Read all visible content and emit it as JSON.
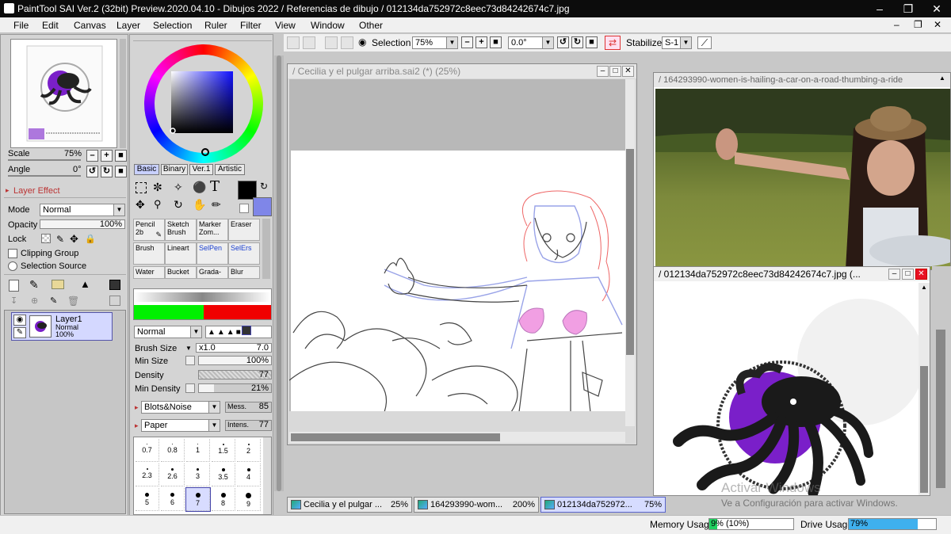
{
  "app": {
    "title": "PaintTool SAI Ver.2 (32bit) Preview.2020.04.10 - Dibujos 2022 / Referencias de dibujo / 012134da752972c8eec73d84242674c7.jpg"
  },
  "menu": [
    "File",
    "Edit",
    "Canvas",
    "Layer",
    "Selection",
    "Ruler",
    "Filter",
    "View",
    "Window",
    "Other"
  ],
  "toolbar": {
    "selection_label": "Selection",
    "zoom": "75%",
    "angle": "0.0°",
    "stabilizer_label": "Stabilizer",
    "stabilizer_value": "S-1"
  },
  "navigator": {
    "scale_label": "Scale",
    "scale_value": "75%",
    "angle_label": "Angle",
    "angle_value": "0°"
  },
  "layer_effect": {
    "header": "Layer Effect",
    "mode_label": "Mode",
    "mode_value": "Normal",
    "opacity_label": "Opacity",
    "opacity_value": "100%",
    "lock_label": "Lock",
    "clipping_label": "Clipping Group",
    "selection_source_label": "Selection Source"
  },
  "layers": [
    {
      "name": "Layer1",
      "mode": "Normal",
      "opacity": "100%"
    }
  ],
  "color_tabs": [
    "Basic",
    "Binary",
    "Ver.1",
    "Artistic"
  ],
  "tools": [
    {
      "label": "Pencil 2b",
      "active": true
    },
    {
      "label": "Sketch Brush"
    },
    {
      "label": "Marker Zom..."
    },
    {
      "label": "Eraser"
    },
    {
      "label": "Brush"
    },
    {
      "label": "Lineart"
    },
    {
      "label": "SelPen"
    },
    {
      "label": "SelErs"
    },
    {
      "label": "Water"
    },
    {
      "label": "Bucket"
    },
    {
      "label": "Grada-"
    },
    {
      "label": "Blur"
    }
  ],
  "brush": {
    "blend_mode": "Normal",
    "size_label": "Brush Size",
    "size_mult": "x1.0",
    "size_value": "7.0",
    "min_size_label": "Min Size",
    "min_size_value": "100%",
    "density_label": "Density",
    "density_value": "77",
    "min_density_label": "Min Density",
    "min_density_value": "21%",
    "blots_label": "Blots&Noise",
    "mess_label": "Mess.",
    "mess_value": "85",
    "paper_label": "Paper",
    "intens_label": "Intens.",
    "intens_value": "77"
  },
  "brush_sizes": [
    "0.7",
    "0.8",
    "1",
    "1.5",
    "2",
    "2.3",
    "2.6",
    "3",
    "3.5",
    "4",
    "5",
    "6",
    "7",
    "8",
    "9"
  ],
  "canvas_windows": [
    {
      "title": "/ Cecilia y el pulgar arriba.sai2 (*) (25%)"
    },
    {
      "title": "/ 164293990-women-is-hailing-a-car-on-a-road-thumbing-a-ride"
    },
    {
      "title": "/ 012134da752972c8eec73d84242674c7.jpg (..."
    }
  ],
  "tabs": [
    {
      "label": "Cecilia y el pulgar ...",
      "pct": "25%"
    },
    {
      "label": "164293990-wom...",
      "pct": "200%"
    },
    {
      "label": "012134da752972...",
      "pct": "75%"
    }
  ],
  "status": {
    "memory_label": "Memory Usage",
    "memory_value": "9% (10%)",
    "memory_fill": 0.09,
    "drive_label": "Drive Usage",
    "drive_value": "79%",
    "drive_fill": 0.79
  },
  "watermark": {
    "line1": "Activar Windows",
    "line2": "Ve a Configuración para activar Windows."
  },
  "colors": {
    "primary": "#000000",
    "secondary": "#7f86e8",
    "accent_purple": "#7a1fc9",
    "select_blue": "#3fb0ee"
  }
}
